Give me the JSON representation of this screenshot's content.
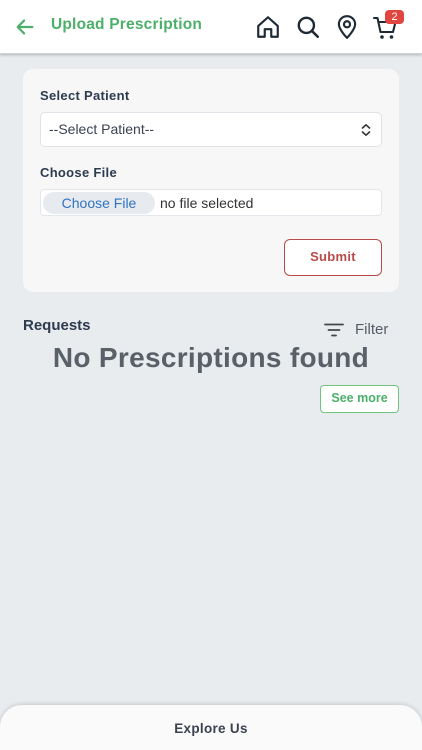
{
  "header": {
    "title": "Upload Prescription",
    "icons": [
      "back-arrow-icon",
      "home-icon",
      "search-icon",
      "location-pin-icon",
      "cart-icon"
    ],
    "cart_count": "2"
  },
  "form": {
    "patient_label": "Select Patient",
    "patient_select_value": "--Select Patient--",
    "file_label": "Choose File",
    "file_button": "Choose File",
    "file_status": "no file selected",
    "submit_label": "Submit"
  },
  "requests": {
    "title": "Requests",
    "filter_label": "Filter",
    "empty_message": "No Prescriptions found",
    "see_more_label": "See more"
  },
  "bottom": {
    "explore_label": "Explore Us"
  },
  "colors": {
    "brand_green": "#4caf6a",
    "submit_red": "#b94a4a",
    "badge_red": "#e0463f",
    "background": "#e9ecef"
  }
}
